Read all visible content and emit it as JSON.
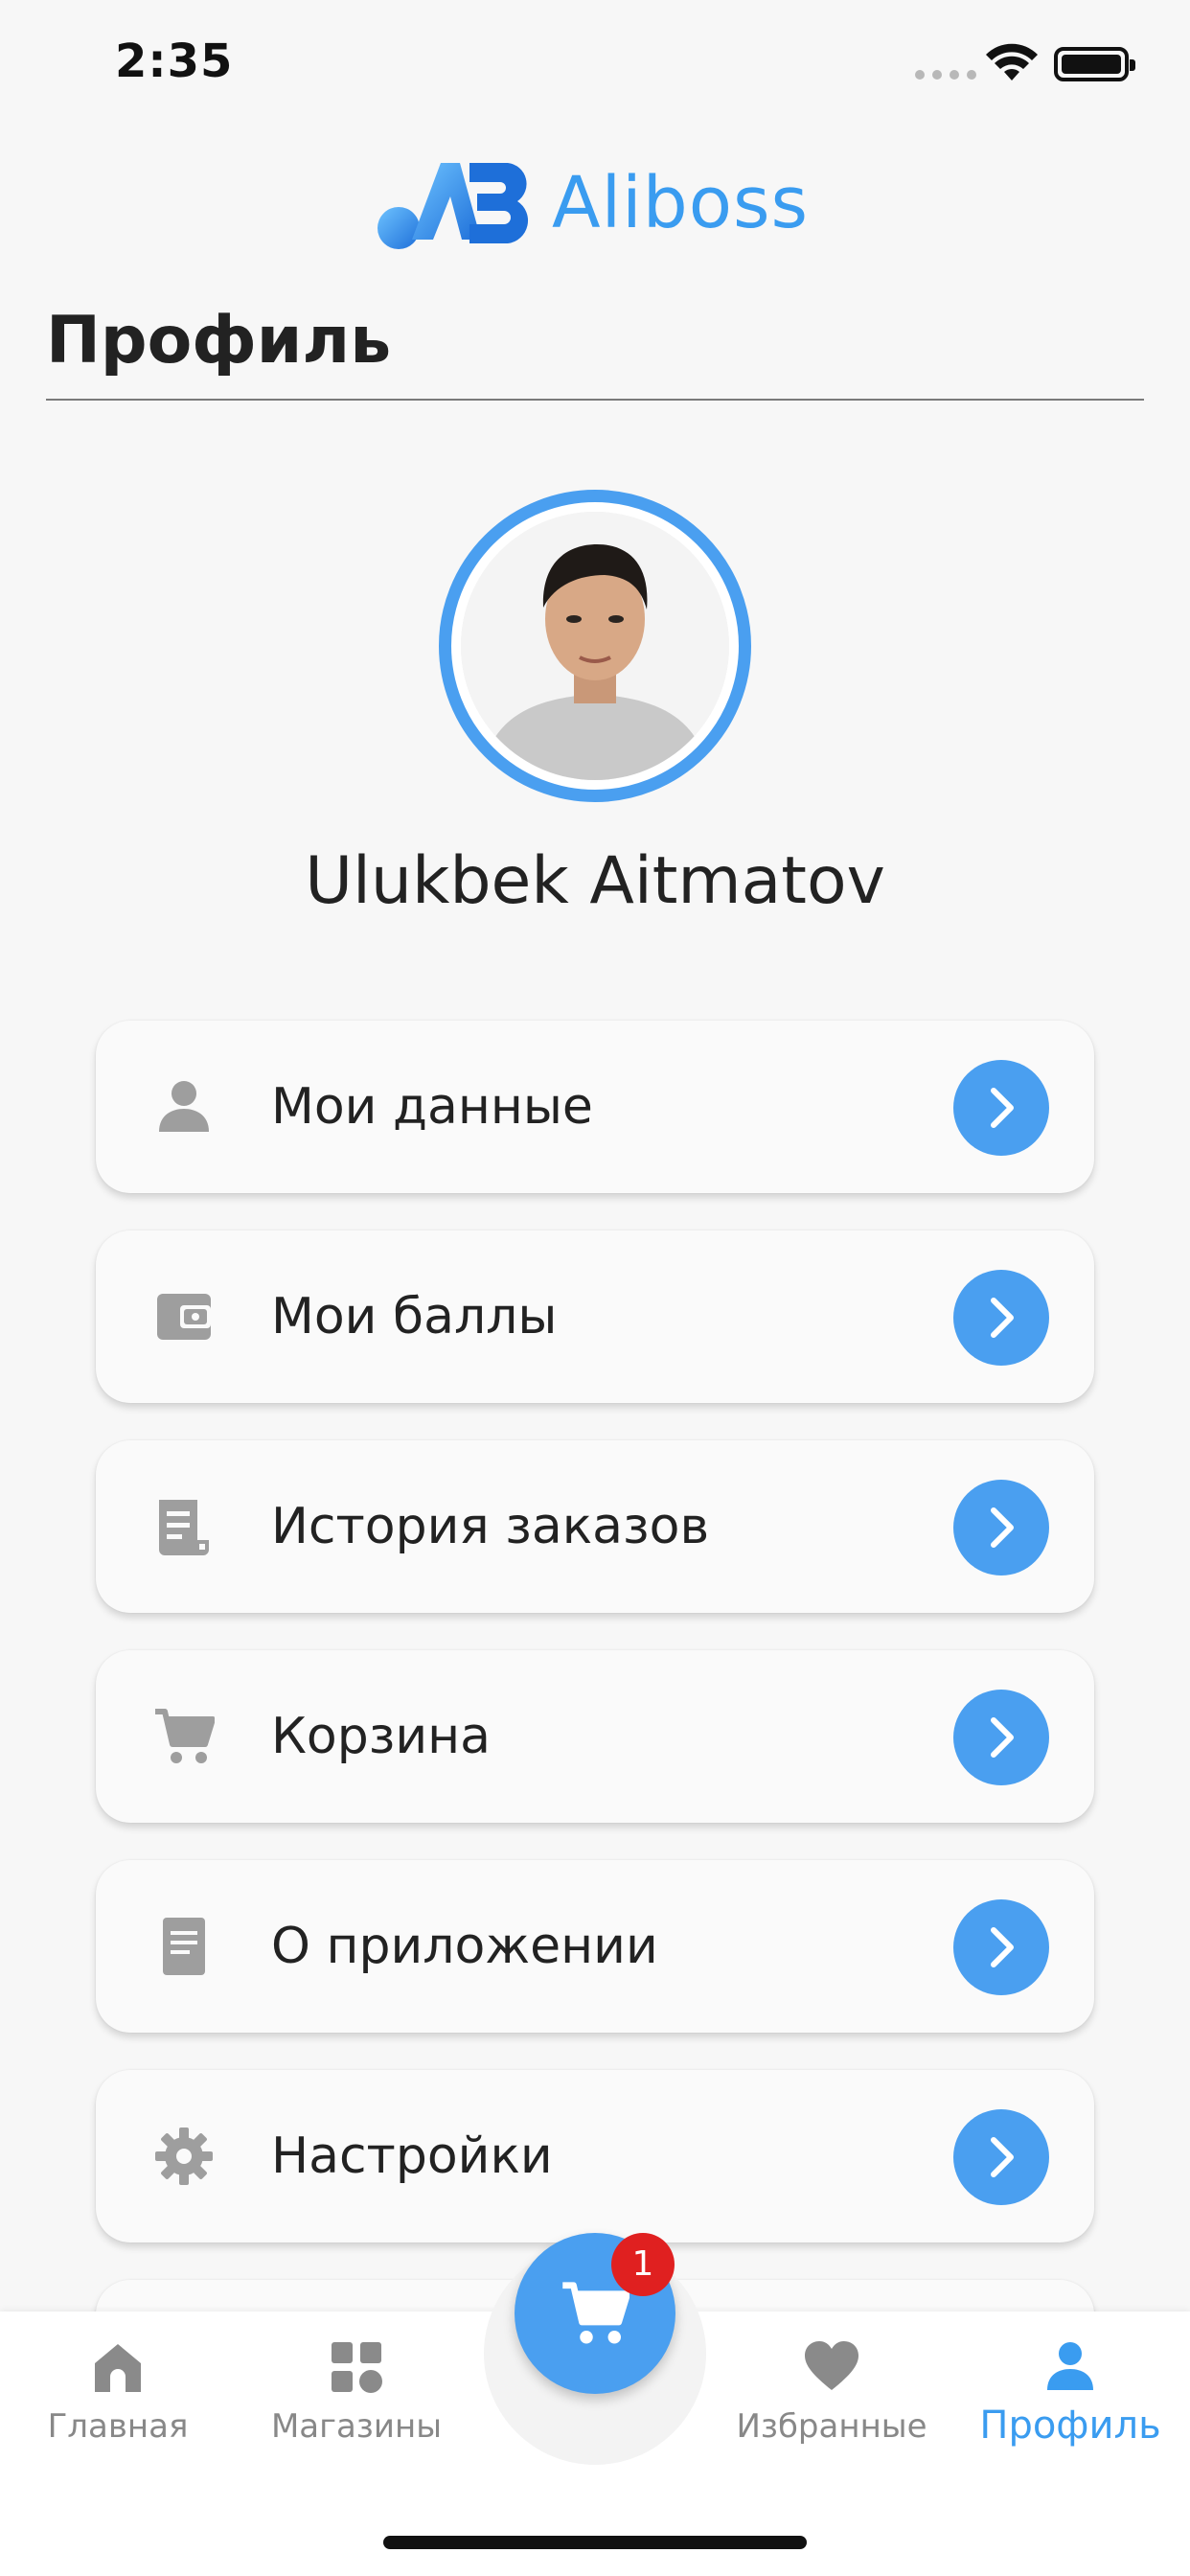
{
  "status_bar": {
    "time": "2:35"
  },
  "brand": {
    "name": "Aliboss",
    "accent": "#3a9cf0"
  },
  "page": {
    "title": "Профиль"
  },
  "profile": {
    "name": "Ulukbek Aitmatov"
  },
  "menu": {
    "items": [
      {
        "label": "Мои данные",
        "icon": "person-icon"
      },
      {
        "label": "Мои баллы",
        "icon": "wallet-icon"
      },
      {
        "label": "История заказов",
        "icon": "receipt-icon"
      },
      {
        "label": "Корзина",
        "icon": "cart-icon"
      },
      {
        "label": "О приложении",
        "icon": "document-icon"
      },
      {
        "label": "Настройки",
        "icon": "gear-icon"
      }
    ]
  },
  "bottom_nav": {
    "items": [
      {
        "label": "Главная",
        "icon": "home-icon"
      },
      {
        "label": "Магазины",
        "icon": "grid-icon"
      },
      {
        "label": "Избранные",
        "icon": "heart-icon"
      },
      {
        "label": "Профиль",
        "icon": "person-icon",
        "active": true
      }
    ],
    "cart_badge": "1"
  }
}
